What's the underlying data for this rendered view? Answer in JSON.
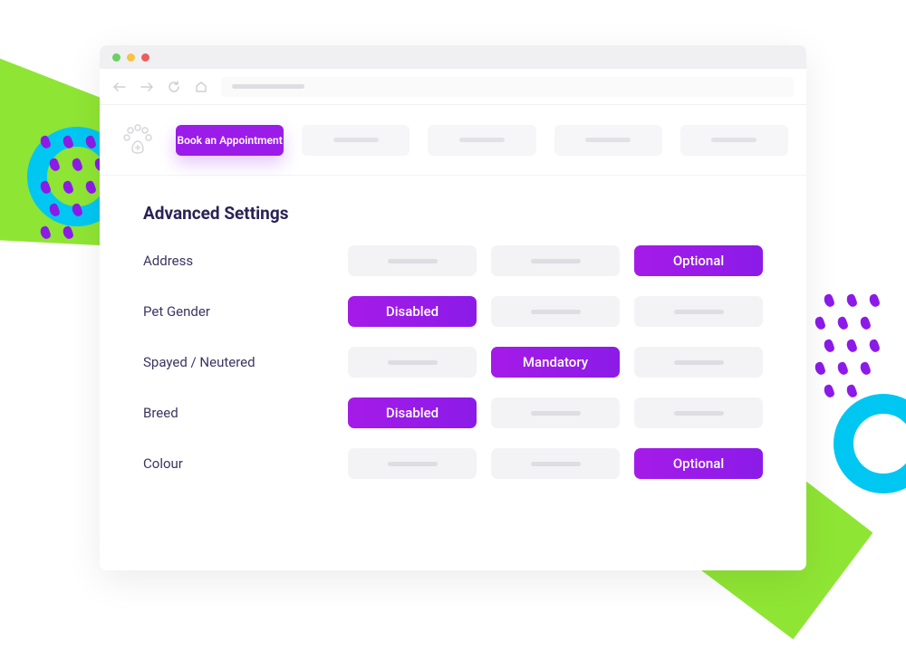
{
  "appbar": {
    "tabs": [
      {
        "label": "Book an Appointment",
        "active": true
      }
    ]
  },
  "content": {
    "title": "Advanced Settings",
    "options": [
      "Disabled",
      "Mandatory",
      "Optional"
    ],
    "rows": [
      {
        "label": "Address",
        "selected": 2
      },
      {
        "label": "Pet Gender",
        "selected": 0
      },
      {
        "label": "Spayed  / Neutered",
        "selected": 1
      },
      {
        "label": "Breed",
        "selected": 0
      },
      {
        "label": "Colour",
        "selected": 2
      }
    ]
  }
}
